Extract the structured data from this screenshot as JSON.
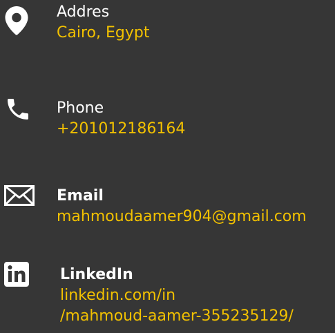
{
  "contact": {
    "address": {
      "icon": "location-pin-icon",
      "label": "Addres",
      "value": "Cairo, Egypt"
    },
    "phone": {
      "icon": "phone-icon",
      "label": "Phone",
      "value": "+201012186164"
    },
    "email": {
      "icon": "envelope-icon",
      "label": "Email",
      "value": "mahmoudaamer904@gmail.com"
    },
    "linkedin": {
      "icon": "linkedin-icon",
      "label": "LinkedIn",
      "value_line1": "linkedin.com/in",
      "value_line2": "/mahmoud-aamer-355235129/"
    }
  },
  "colors": {
    "background": "#363636",
    "label": "#ffffff",
    "value": "#f2c100",
    "icon": "#ffffff"
  }
}
